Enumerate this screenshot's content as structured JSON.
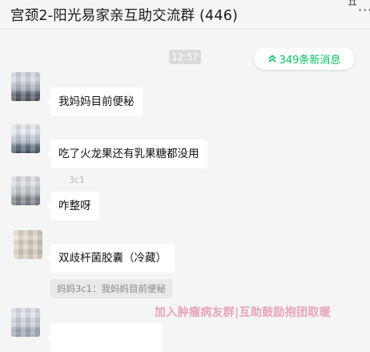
{
  "window": {
    "title": "宫颈2-阳光易家亲互助交流群 (446)"
  },
  "chat": {
    "time_divider": "12:57",
    "new_messages": {
      "label": "349条新消息",
      "icon": "double-chevron-up-icon",
      "color": "#07c160"
    },
    "messages": [
      {
        "text": "我妈妈目前便秘"
      },
      {
        "text": "吃了火龙果还有乳果糖都没用"
      },
      {
        "sender_partial": "3c1",
        "text": "咋整呀"
      },
      {
        "text": "双歧杆菌胶囊（冷藏）",
        "quote": "妈妈3c1：我妈妈目前便秘"
      }
    ]
  },
  "overlay": {
    "watermark": "加入肿瘤病友群|互助鼓励抱团取暖",
    "watermark_color": "#e8a0b6"
  }
}
